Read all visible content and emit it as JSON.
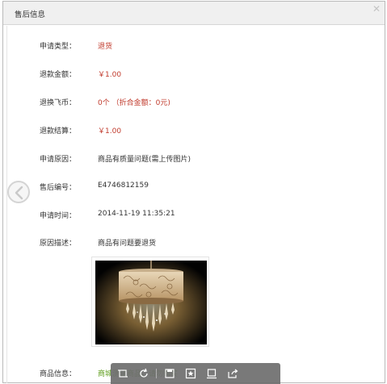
{
  "dialog": {
    "title": "售后信息"
  },
  "fields": [
    {
      "label": "申请类型：",
      "value": "退货"
    },
    {
      "label": "退款金额：",
      "value": "￥1.00"
    },
    {
      "label": "退换飞币：",
      "value": "0个 （折合金额：0元)"
    },
    {
      "label": "退款结算：",
      "value": "￥1.00"
    },
    {
      "label": "申请原因：",
      "value": "商品有质量问题(需上传图片)"
    },
    {
      "label": "售后编号：",
      "value": "E4746812159"
    },
    {
      "label": "申请时间：",
      "value": "2014-11-19 11:35:21"
    },
    {
      "label": "原因描述：",
      "value": "商品有问题要退货"
    }
  ],
  "product": {
    "label": "商品信息：",
    "value": "商城测试商品，请勿购买"
  },
  "colors": {
    "accent_red": "#c0392b",
    "link_green": "#5c9c1a",
    "toolbar_bg": "#6e6e6e"
  },
  "icons": {
    "close": "close-icon",
    "prev": "chevron-left-icon",
    "toolbar": [
      "crop-icon",
      "rotate-icon",
      "save-icon",
      "star-icon",
      "fit-icon",
      "share-icon"
    ]
  }
}
